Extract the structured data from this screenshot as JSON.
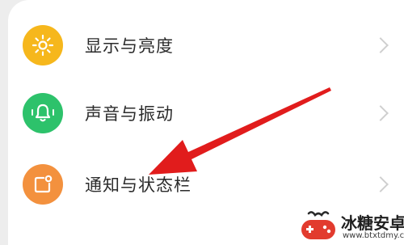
{
  "settings": {
    "items": [
      {
        "label": "显示与亮度",
        "icon": "sun-icon",
        "color": "#f6b71c"
      },
      {
        "label": "声音与振动",
        "icon": "bell-icon",
        "color": "#2dc26b"
      },
      {
        "label": "通知与状态栏",
        "icon": "notification-icon",
        "color": "#f3913e"
      }
    ]
  },
  "annotation": {
    "arrow_color": "#e11c1c"
  },
  "watermark": {
    "title": "冰糖安卓网",
    "url": "www.btxtdmy.com"
  }
}
